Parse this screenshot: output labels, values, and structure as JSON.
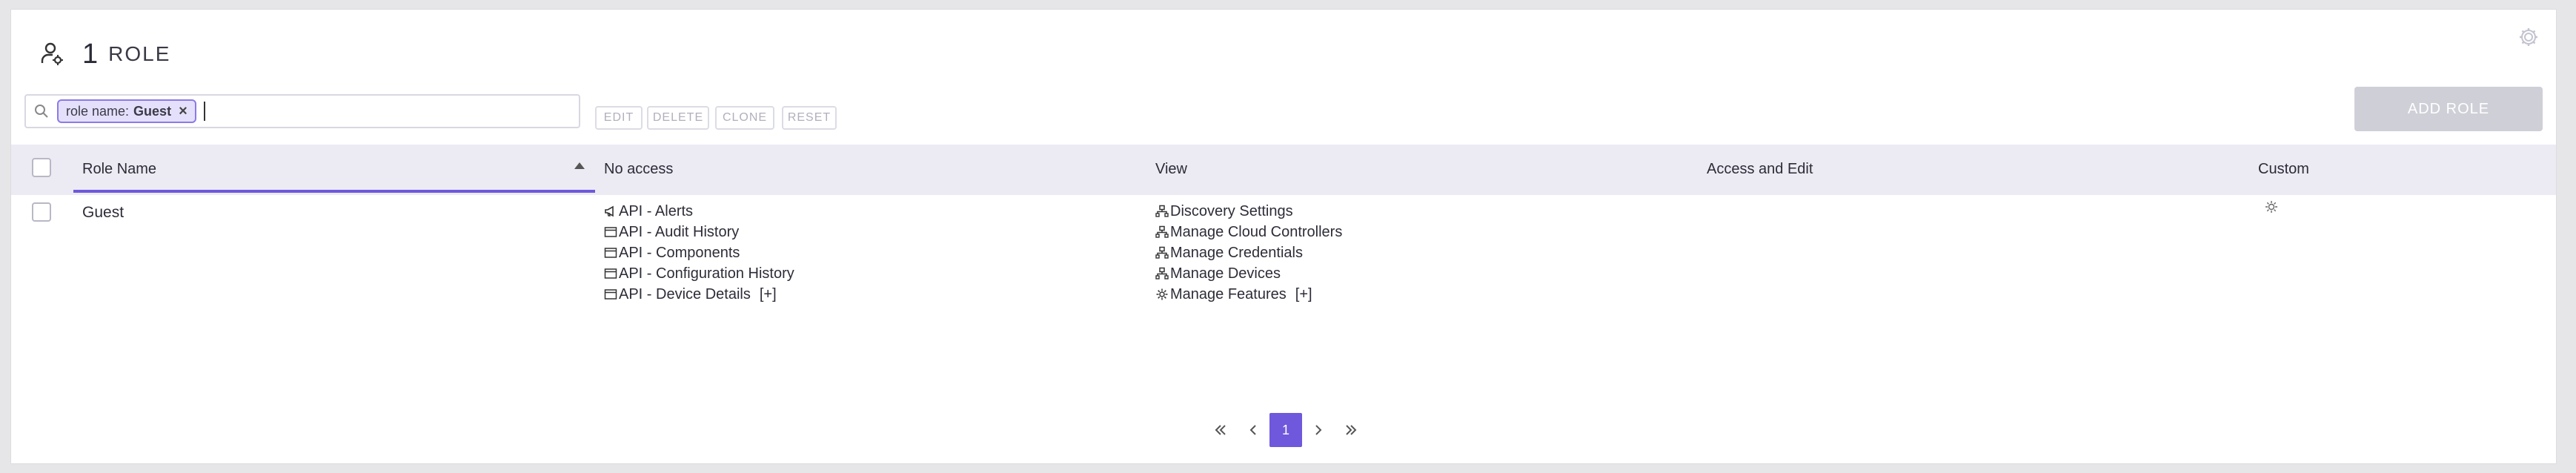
{
  "header": {
    "count": "1",
    "title": "ROLE"
  },
  "search": {
    "chip_key": "role name:",
    "chip_value": "Guest",
    "chip_close": "×"
  },
  "toolbar": {
    "edit_label": "EDIT",
    "delete_label": "DELETE",
    "clone_label": "CLONE",
    "reset_label": "RESET",
    "add_role_label": "ADD ROLE"
  },
  "table": {
    "columns": {
      "role_name": "Role Name",
      "no_access": "No access",
      "view": "View",
      "access_edit": "Access and Edit",
      "custom": "Custom"
    },
    "rows": [
      {
        "role_name": "Guest",
        "no_access": [
          {
            "icon": "megaphone-icon",
            "label": "API - Alerts"
          },
          {
            "icon": "window-icon",
            "label": "API - Audit History"
          },
          {
            "icon": "window-icon",
            "label": "API - Components"
          },
          {
            "icon": "window-icon",
            "label": "API - Configuration History"
          },
          {
            "icon": "window-icon",
            "label": "API - Device Details"
          }
        ],
        "no_access_more": "[+]",
        "view": [
          {
            "icon": "network-icon",
            "label": "Discovery Settings"
          },
          {
            "icon": "network-icon",
            "label": "Manage Cloud Controllers"
          },
          {
            "icon": "network-icon",
            "label": "Manage Credentials"
          },
          {
            "icon": "network-icon",
            "label": "Manage Devices"
          },
          {
            "icon": "gear-icon",
            "label": "Manage Features"
          }
        ],
        "view_more": "[+]",
        "custom_icon": "gear-icon"
      }
    ]
  },
  "pagination": {
    "current_page": "1"
  },
  "colors": {
    "accent": "#6f58dc",
    "header_bg": "#ecebf3",
    "chip_bg": "#e4e0fb",
    "disabled_btn": "#cfcfd8"
  }
}
